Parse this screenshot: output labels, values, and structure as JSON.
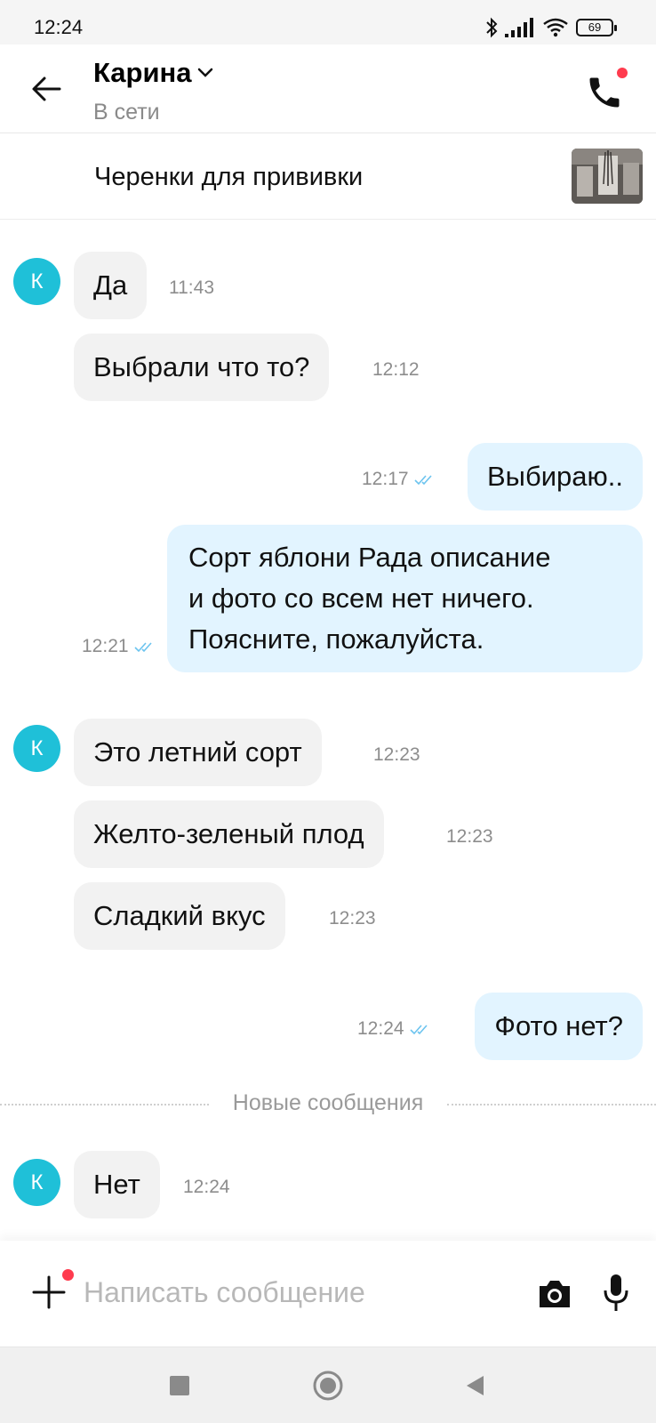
{
  "status_bar": {
    "time": "12:24",
    "battery": "69"
  },
  "header": {
    "contact_name": "Карина",
    "contact_status": "В сети"
  },
  "listing": {
    "title": "Черенки для прививки"
  },
  "messages": [
    {
      "direction": "in",
      "text": "Да",
      "time": "11:43",
      "avatar": "К"
    },
    {
      "direction": "in",
      "text": "Выбрали что то?",
      "time": "12:12"
    },
    {
      "direction": "out",
      "text": "Выбираю..",
      "time": "12:17",
      "status": "read"
    },
    {
      "direction": "out",
      "lines": [
        "Сорт яблони Рада описание",
        "и фото со всем нет ничего.",
        "Поясните, пожалуйста."
      ],
      "time": "12:21",
      "status": "read"
    },
    {
      "direction": "in",
      "text": "Это летний сорт",
      "time": "12:23",
      "avatar": "К"
    },
    {
      "direction": "in",
      "text": "Желто-зеленый плод",
      "time": "12:23"
    },
    {
      "direction": "in",
      "text": "Сладкий вкус",
      "time": "12:23"
    },
    {
      "direction": "out",
      "text": "Фото нет?",
      "time": "12:24",
      "status": "read"
    },
    {
      "direction": "in",
      "text": "Нет",
      "time": "12:24",
      "avatar": "К"
    }
  ],
  "divider": {
    "label": "Новые сообщения"
  },
  "composer": {
    "placeholder": "Написать сообщение"
  },
  "icons": {
    "back": "arrow-left-icon",
    "dropdown": "chevron-down-icon",
    "call": "phone-icon",
    "attach": "plus-icon",
    "camera": "camera-icon",
    "mic": "microphone-icon",
    "read_receipt": "double-check-icon"
  },
  "colors": {
    "avatar": "#1fc0d8",
    "incoming_bubble": "#f2f2f2",
    "outgoing_bubble": "#e2f4ff",
    "notification_dot": "#ff3b4e",
    "read_check": "#6cc4ef"
  }
}
